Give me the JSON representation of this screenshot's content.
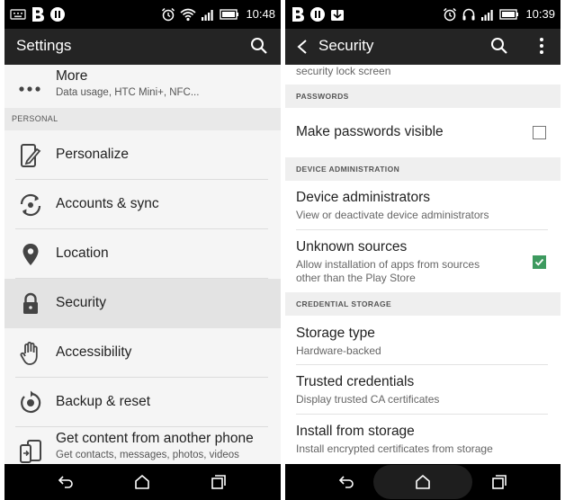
{
  "left": {
    "status": {
      "time": "10:48"
    },
    "appbar": {
      "title": "Settings"
    },
    "more": {
      "label": "More",
      "subtitle": "Data usage, HTC Mini+, NFC..."
    },
    "section_personal": "PERSONAL",
    "items": [
      {
        "label": "Personalize",
        "icon": "personalize-icon"
      },
      {
        "label": "Accounts & sync",
        "icon": "sync-icon"
      },
      {
        "label": "Location",
        "icon": "location-pin-icon"
      },
      {
        "label": "Security",
        "icon": "lock-icon",
        "selected": true
      },
      {
        "label": "Accessibility",
        "icon": "hand-icon"
      },
      {
        "label": "Backup & reset",
        "icon": "backup-icon"
      }
    ],
    "get_content": {
      "label": "Get content from another phone",
      "subtitle": "Get contacts, messages, photos, videos"
    }
  },
  "right": {
    "status": {
      "time": "10:39"
    },
    "appbar": {
      "title": "Security"
    },
    "top_partial": "security lock screen",
    "sections": {
      "passwords": "PASSWORDS",
      "device_admin": "DEVICE ADMINISTRATION",
      "credential": "CREDENTIAL STORAGE"
    },
    "make_passwords_visible": {
      "title": "Make passwords visible",
      "checked": false
    },
    "device_administrators": {
      "title": "Device administrators",
      "subtitle": "View or deactivate device administrators"
    },
    "unknown_sources": {
      "title": "Unknown sources",
      "subtitle_line1": "Allow installation of apps from sources",
      "subtitle_line2": "other than the Play Store",
      "checked": true
    },
    "storage_type": {
      "title": "Storage type",
      "subtitle": "Hardware-backed"
    },
    "trusted_credentials": {
      "title": "Trusted credentials",
      "subtitle": "Display trusted CA certificates"
    },
    "install_from_storage": {
      "title": "Install from storage",
      "subtitle": "Install encrypted certificates from storage"
    }
  },
  "colors": {
    "statusbar": "#000000",
    "appbar": "#242424",
    "accent_checkbox": "#3d9a5f",
    "selected_row": "#e3e3e3"
  }
}
